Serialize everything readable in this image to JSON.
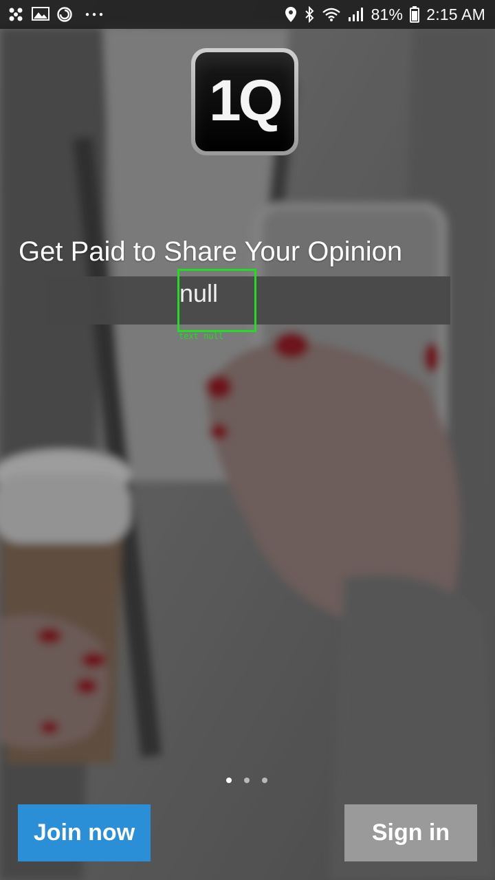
{
  "status_bar": {
    "left_icons": [
      "pinwheel-icon",
      "gallery-mail-icon",
      "sync-circle-icon",
      "more-dots-icon"
    ],
    "right_icons": [
      "location-icon",
      "bluetooth-icon",
      "wifi-icon",
      "signal-icon",
      "battery-icon"
    ],
    "battery_percent": "81%",
    "time": "2:15 AM"
  },
  "logo": {
    "text": "1Q"
  },
  "onboarding": {
    "headline": "Get Paid to Share Your Opinion",
    "subtext": "null",
    "debug_label": "text null",
    "pages": 3,
    "active_page": 1
  },
  "actions": {
    "join_label": "Join now",
    "signin_label": "Sign in"
  },
  "colors": {
    "join_button": "#2a8fd6",
    "signin_button": "#9a9a9a",
    "debug_outline": "#22dd22"
  }
}
